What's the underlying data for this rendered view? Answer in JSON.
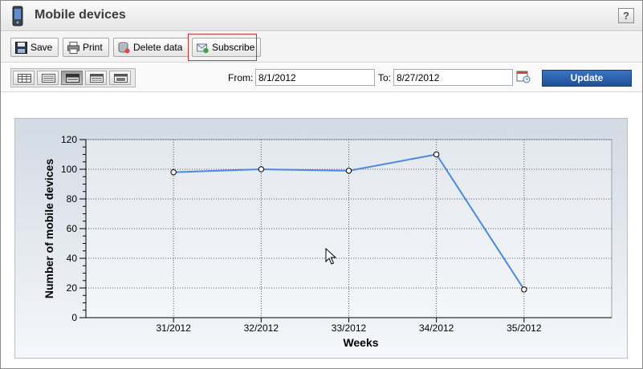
{
  "window": {
    "title": "Mobile devices",
    "help_label": "?"
  },
  "toolbar": {
    "save_label": "Save",
    "print_label": "Print",
    "delete_label": "Delete data",
    "subscribe_label": "Subscribe"
  },
  "filter": {
    "from_label": "From:",
    "from_value": "8/1/2012",
    "to_label": "To:",
    "to_value": "8/27/2012",
    "update_label": "Update"
  },
  "colors": {
    "accent": "#2b5fab",
    "series_line": "#4a8ae0",
    "highlight_frame": "#d03030"
  },
  "chart_data": {
    "type": "line",
    "title": "",
    "xlabel": "Weeks",
    "ylabel": "Number of mobile devices",
    "categories": [
      "31/2012",
      "32/2012",
      "33/2012",
      "34/2012",
      "35/2012"
    ],
    "series": [
      {
        "values": [
          98,
          100,
          99,
          110,
          19
        ]
      }
    ],
    "ylim": [
      0,
      120
    ],
    "yticks": [
      0,
      20,
      40,
      60,
      80,
      100,
      120
    ],
    "grid": true,
    "legend": "none"
  }
}
